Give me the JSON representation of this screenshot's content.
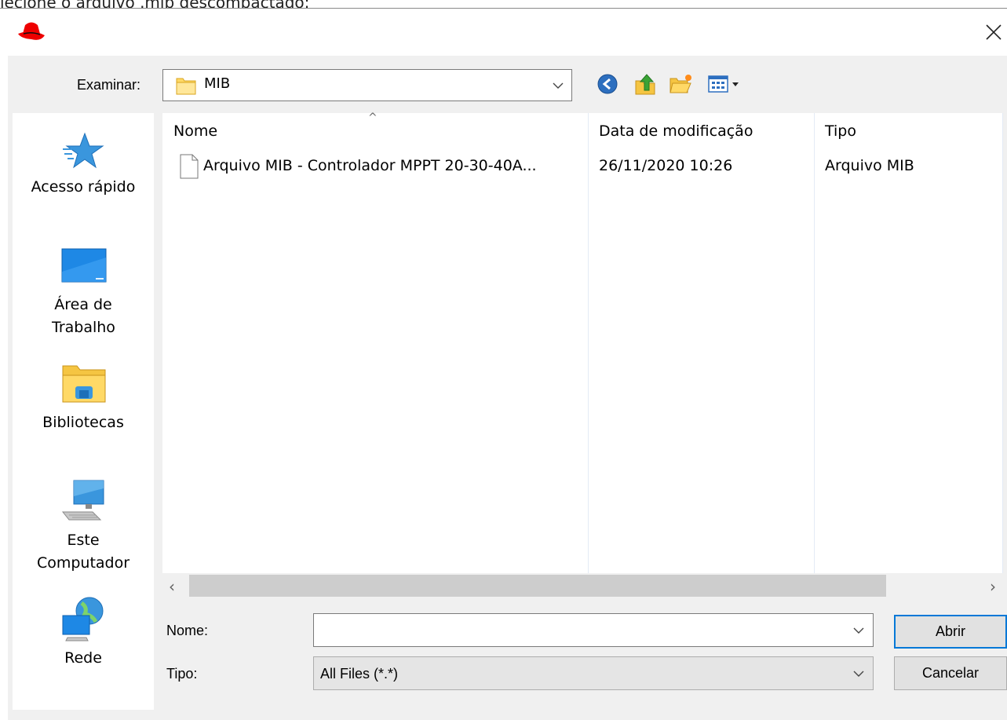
{
  "caption": "lecione o arquivo .mib descompactado:",
  "dialog": {
    "look_in_label": "Examinar:",
    "look_in_value": "MIB",
    "places": [
      {
        "label": "Acesso rápido",
        "icon": "quick-access-star-icon"
      },
      {
        "label": "Área de Trabalho",
        "icon": "desktop-icon"
      },
      {
        "label": "Bibliotecas",
        "icon": "libraries-icon"
      },
      {
        "label": "Este Computador",
        "icon": "computer-icon"
      },
      {
        "label": "Rede",
        "icon": "network-icon"
      }
    ],
    "columns": [
      "Nome",
      "Data de modificação",
      "Tipo"
    ],
    "files": [
      {
        "name": "Arquivo MIB - Controlador MPPT 20-30-40A...",
        "modified": "26/11/2020 10:26",
        "type": "Arquivo MIB"
      }
    ],
    "file_name_label": "Nome:",
    "file_name_value": "",
    "file_type_label": "Tipo:",
    "file_type_value": "All Files (*.*)",
    "open_label": "Abrir",
    "cancel_label": "Cancelar"
  },
  "colors": {
    "accent": "#0078d7",
    "dialog_bg": "#f0f0f0",
    "logo_red": "#ee0000"
  }
}
